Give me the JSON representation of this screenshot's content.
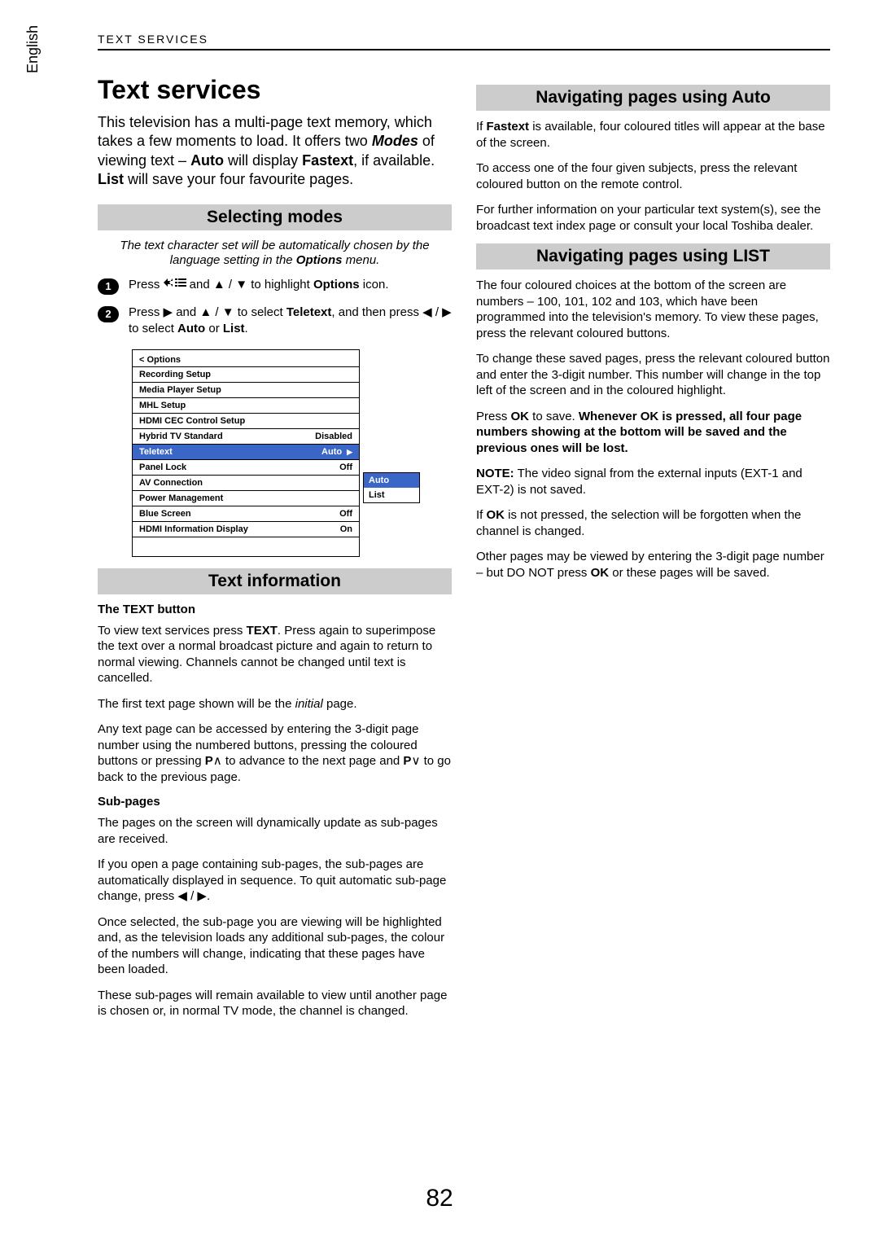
{
  "header": "TEXT SERVICES",
  "language": "English",
  "pageNumber": "82",
  "mainTitle": "Text services",
  "intro": {
    "p1a": "This television has a multi-page text memory, which takes a few moments to load. It offers two ",
    "modes": "Modes",
    "p1b": " of viewing text – ",
    "auto": "Auto",
    "p1c": " will display ",
    "fastext": "Fastext",
    "p1d": ", if available. ",
    "list": "List",
    "p1e": " will save your four favourite pages."
  },
  "selecting": {
    "title": "Selecting modes",
    "note_a": "The text character set will be automatically chosen by the language setting in the ",
    "note_b": "Options",
    "note_c": " menu.",
    "step1": {
      "num": "1",
      "a": "Press ",
      "b": " and ▲ / ▼ to highlight ",
      "c": "Options",
      "d": " icon."
    },
    "step2": {
      "num": "2",
      "a": "Press ▶ and ▲ / ▼ to select ",
      "b": "Teletext",
      "c": ", and then press ◀ / ▶ to select ",
      "d": "Auto",
      "e": " or ",
      "f": "List",
      "g": "."
    }
  },
  "osd": {
    "header": "< Options",
    "rows": [
      {
        "label": "Recording Setup",
        "value": ""
      },
      {
        "label": "Media Player Setup",
        "value": ""
      },
      {
        "label": "MHL Setup",
        "value": ""
      },
      {
        "label": "HDMI CEC Control Setup",
        "value": ""
      },
      {
        "label": "Hybrid TV Standard",
        "value": "Disabled"
      },
      {
        "label": "Teletext",
        "value": "Auto",
        "selected": true,
        "arrow": true
      },
      {
        "label": "Panel Lock",
        "value": "Off"
      },
      {
        "label": "AV Connection",
        "value": ""
      },
      {
        "label": "Power Management",
        "value": ""
      },
      {
        "label": "Blue Screen",
        "value": "Off"
      },
      {
        "label": "HDMI Information Display",
        "value": "On"
      }
    ],
    "popup": {
      "opt1": "Auto",
      "opt2": "List"
    }
  },
  "textInfo": {
    "title": "Text information",
    "h1": "The TEXT button",
    "p1a": "To view text services press ",
    "p1b": "TEXT",
    "p1c": ". Press again to superimpose the text over a normal broadcast picture and again to return to normal viewing. Channels cannot be changed until text is cancelled.",
    "p2a": "The first text page shown will be the ",
    "p2b": "initial",
    "p2c": " page.",
    "p3": "Any text page can be accessed by entering the 3-digit page number using the numbered buttons, pressing the coloured buttons or pressing ",
    "p3b": "P",
    "p3c": " to advance to the next page and ",
    "p3d": "P",
    "p3e": " to go back to the previous page.",
    "h2": "Sub-pages",
    "p4": "The pages on the screen will dynamically update as sub-pages are received.",
    "p5": "If you open a page containing sub-pages, the sub-pages are automatically displayed in sequence. To quit automatic sub-page change, press ◀ / ▶.",
    "p6": "Once selected, the sub-page you are viewing will be highlighted and, as the television loads any additional sub-pages, the colour of the numbers will change, indicating that these pages have been loaded.",
    "p7": "These sub-pages will remain available to view until another page is chosen or, in normal TV mode, the channel is changed."
  },
  "navAuto": {
    "title": "Navigating pages using Auto",
    "p1a": "If ",
    "p1b": "Fastext",
    "p1c": " is available, four coloured titles will appear at the base of the screen.",
    "p2": "To access one of the four given subjects, press the relevant coloured button on the remote control.",
    "p3": "For further information on your particular text system(s), see the broadcast text index page or consult your local Toshiba dealer."
  },
  "navList": {
    "title": "Navigating pages using LIST",
    "p1": "The four coloured choices at the bottom of the screen are numbers – 100, 101, 102 and 103, which have been programmed into the television's memory. To view these pages, press the relevant coloured buttons.",
    "p2": "To change these saved pages, press the relevant coloured button and enter the 3-digit number. This number will change in the top left of the screen and in the coloured highlight.",
    "p3a": "Press ",
    "p3b": "OK",
    "p3c": " to save. ",
    "p3d": "Whenever OK is pressed, all four page numbers showing at the bottom will be saved and the previous ones will be lost.",
    "p4a": "NOTE:",
    "p4b": " The video signal from the external inputs (EXT-1 and EXT-2) is not saved.",
    "p5a": "If ",
    "p5b": "OK",
    "p5c": " is not pressed, the selection will be forgotten when the channel is changed.",
    "p6a": "Other pages may be viewed by entering the 3-digit page number – but DO NOT press ",
    "p6b": "OK",
    "p6c": " or these pages will be saved."
  }
}
